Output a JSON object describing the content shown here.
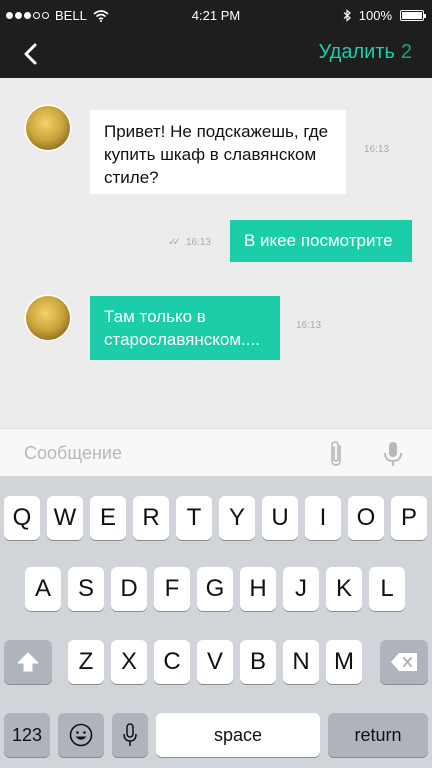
{
  "status_bar": {
    "carrier": "BELL",
    "time": "4:21 PM",
    "battery": "100%",
    "signal_icon": "signal-dots-icon",
    "wifi_icon": "wifi-icon",
    "bluetooth_icon": "bluetooth-icon",
    "battery_icon": "battery-icon"
  },
  "nav": {
    "back_icon": "chevron-left-icon",
    "delete_label": "Удалить",
    "delete_count": "2"
  },
  "messages": [
    {
      "side": "incoming",
      "text": "Привет! Не подскажешь, где купить шкаф в славянском стиле?",
      "time": "16:13"
    },
    {
      "side": "outgoing",
      "text": "В икее посмотрите",
      "time": "16:13"
    },
    {
      "side": "incoming",
      "text": "Там только в старославянском....",
      "time": "16:13"
    }
  ],
  "composer": {
    "placeholder": "Сообщение",
    "attach_icon": "paperclip-icon",
    "mic_icon": "microphone-icon"
  },
  "keyboard": {
    "row1": [
      "Q",
      "W",
      "E",
      "R",
      "T",
      "Y",
      "U",
      "I",
      "O",
      "P"
    ],
    "row2": [
      "A",
      "S",
      "D",
      "F",
      "G",
      "H",
      "J",
      "K",
      "L"
    ],
    "row3": [
      "Z",
      "X",
      "C",
      "V",
      "B",
      "N",
      "M"
    ],
    "numbers_label": "123",
    "space_label": "space",
    "return_label": "return"
  },
  "colors": {
    "accent": "#1ccdaa",
    "nav_bg": "#1e1e1e",
    "chat_bg": "#ececec"
  }
}
